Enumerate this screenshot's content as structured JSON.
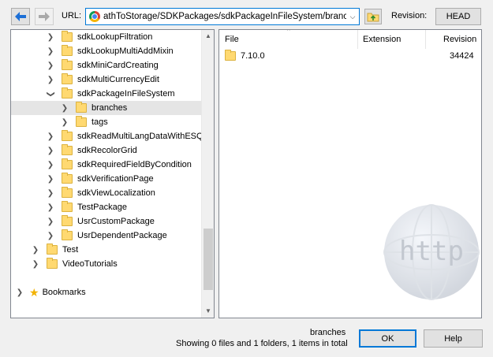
{
  "toolbar": {
    "url_label": "URL:",
    "url_value": "athToStorage/SDKPackages/sdkPackageInFileSystem/branches",
    "revision_label": "Revision:",
    "revision_button": "HEAD"
  },
  "icons": {
    "back": "arrow-left-icon",
    "forward": "arrow-right-icon",
    "browser": "chrome-icon",
    "browse": "folder-up-icon",
    "folder": "folder-icon",
    "star": "star-icon",
    "watermark": "http-globe-icon"
  },
  "colors": {
    "accent": "#0078d7",
    "selected_row": "#e5e5e5",
    "folder": "#ffd971"
  },
  "tree": {
    "items": [
      {
        "label": "sdkLookupFiltration",
        "expander": "collapsed"
      },
      {
        "label": "sdkLookupMultiAddMixin",
        "expander": "collapsed"
      },
      {
        "label": "sdkMiniCardCreating",
        "expander": "collapsed"
      },
      {
        "label": "sdkMultiCurrencyEdit",
        "expander": "collapsed"
      },
      {
        "label": "sdkPackageInFileSystem",
        "expander": "expanded"
      },
      {
        "label": "branches",
        "expander": "collapsed",
        "selected": true
      },
      {
        "label": "tags",
        "expander": "collapsed"
      },
      {
        "label": "sdkReadMultiLangDataWithESQ",
        "expander": "collapsed"
      },
      {
        "label": "sdkRecolorGrid",
        "expander": "collapsed"
      },
      {
        "label": "sdkRequiredFieldByCondition",
        "expander": "collapsed"
      },
      {
        "label": "sdkVerificationPage",
        "expander": "collapsed"
      },
      {
        "label": "sdkViewLocalization",
        "expander": "collapsed"
      },
      {
        "label": "TestPackage",
        "expander": "collapsed"
      },
      {
        "label": "UsrCustomPackage",
        "expander": "collapsed"
      },
      {
        "label": "UsrDependentPackage",
        "expander": "collapsed"
      },
      {
        "label": "Test",
        "expander": "collapsed"
      },
      {
        "label": "VideoTutorials",
        "expander": "collapsed"
      },
      {
        "label": "Bookmarks",
        "expander": "collapsed"
      }
    ]
  },
  "list": {
    "columns": [
      "File",
      "Extension",
      "Revision"
    ],
    "sort_column": "File",
    "rows": [
      {
        "name": "7.10.0",
        "extension": "",
        "revision": "34424"
      }
    ]
  },
  "status": {
    "current_name": "branches",
    "summary": "Showing 0 files and 1 folders, 1 items in total"
  },
  "buttons": {
    "ok": "OK",
    "help": "Help"
  }
}
